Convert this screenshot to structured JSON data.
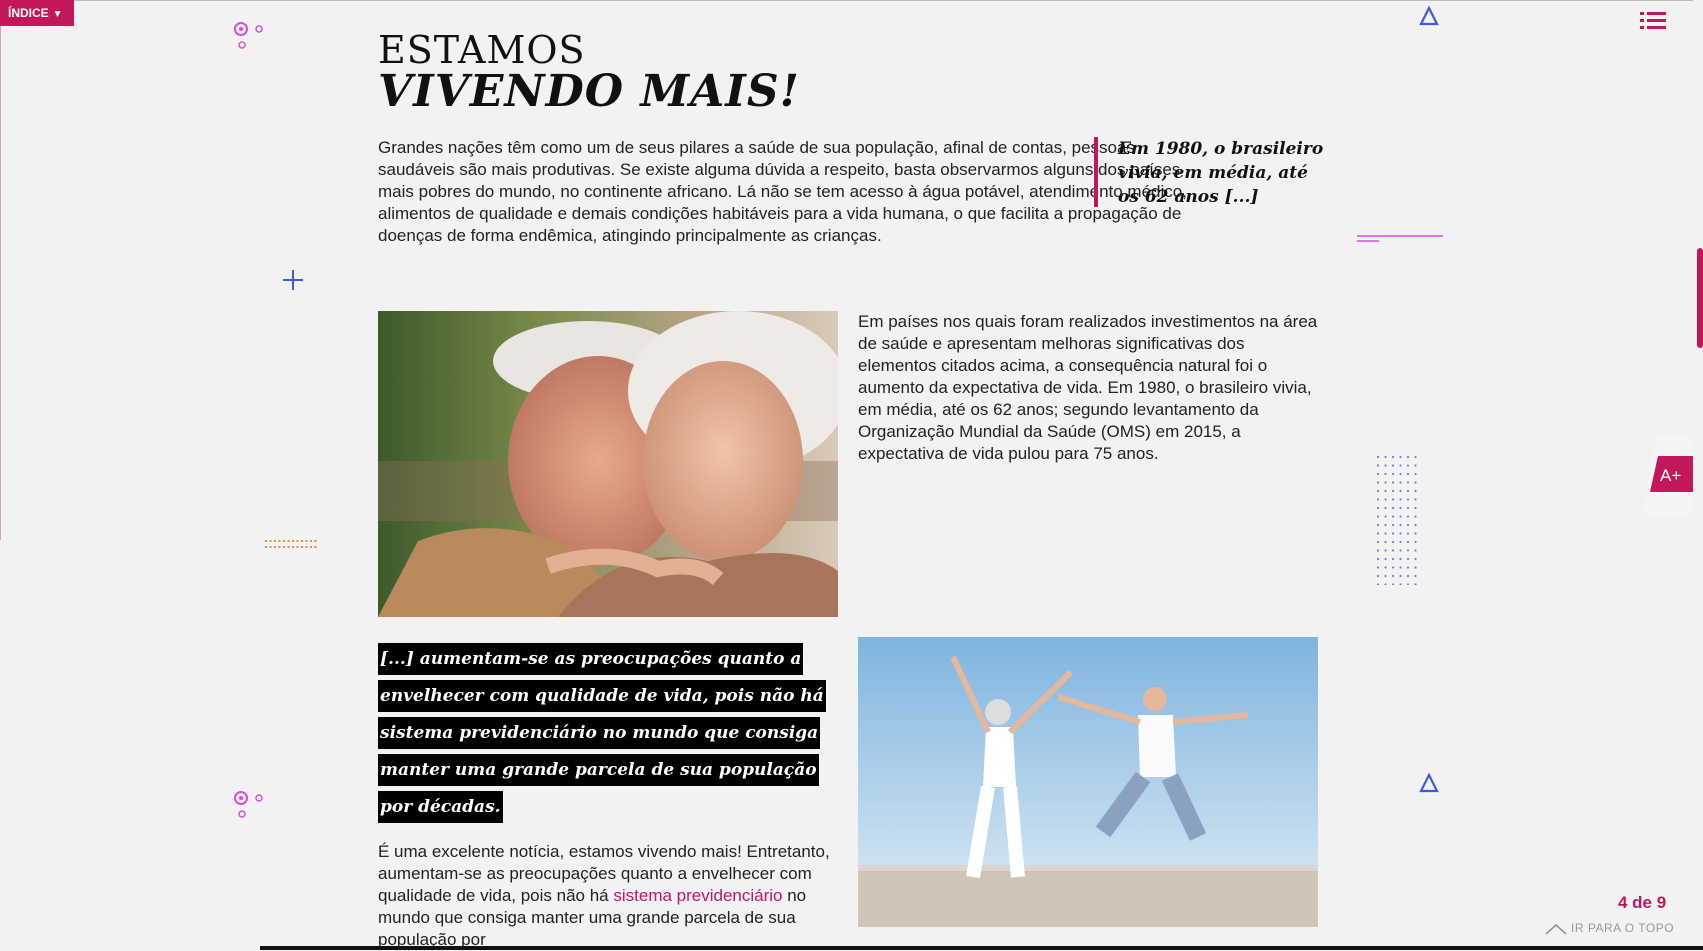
{
  "nav": {
    "indice_label": "ÍNDICE",
    "page_counter": "4 de 9",
    "back_to_top": "IR PARA O TOPO",
    "font_size_label": "A+"
  },
  "article": {
    "title_line1": "ESTAMOS",
    "title_line2": "VIVENDO MAIS!",
    "intro": "Grandes nações têm como um de seus pilares a saúde de sua população, afinal de contas, pessoas saudáveis são mais produtivas. Se existe alguma dúvida a respeito, basta observarmos alguns dos países mais pobres do mundo, no continente africano. Lá não se tem acesso à água potável, atendimento médico, alimentos de qualidade e demais condições habitáveis para a vida humana, o que facilita a propagação de doenças de forma endêmica, atingindo principalmente as crianças.",
    "pullquote": "Em 1980, o brasileiro vivia, em média, até os 62 anos [...]",
    "paragraph2": "Em países nos quais foram realizados investimentos na área de saúde e apresentam melhoras significativas dos elementos citados acima, a consequência natural foi o aumento da expectativa de vida. Em 1980, o brasileiro vivia, em média, até os 62 anos; segundo levantamento da Organização Mundial da Saúde (OMS) em 2015, a expectativa de vida pulou para 75 anos.",
    "highlight_quote": "[...] aumentam-se as preocupações quanto a envelhecer com qualidade de vida, pois não há sistema previdenciário no mundo que consiga manter uma grande parcela de sua população por décadas.",
    "paragraph3_before": "É uma excelente notícia, estamos vivendo mais! Entretanto, aumentam-se as preocupações quanto a envelhecer com qualidade de vida, pois não há ",
    "paragraph3_link": "sistema previdenciário",
    "paragraph3_after": " no mundo que consiga manter uma grande parcela de sua população por"
  },
  "icons": {
    "menu": "list-icon",
    "back_top": "chevron-up-icon",
    "decor": [
      "circles-icon",
      "plus-icon",
      "triangle-icon",
      "dot-grid-icon",
      "dashed-line-icon"
    ]
  },
  "colors": {
    "accent": "#c2185b",
    "decor_pink": "#d64fd6",
    "decor_blue": "#3f5bd6",
    "decor_orange": "#f08a3c"
  }
}
